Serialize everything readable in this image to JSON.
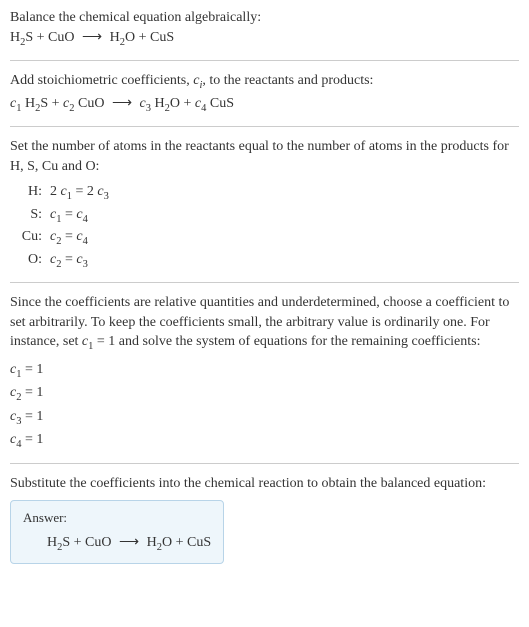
{
  "section1": {
    "line1": "Balance the chemical equation algebraically:",
    "eq_h2s": "H",
    "eq_2a": "2",
    "eq_s": "S + CuO ",
    "eq_arrow": "⟶",
    "eq_h2o": " H",
    "eq_2b": "2",
    "eq_o_cus": "O + CuS"
  },
  "section2": {
    "line1a": "Add stoichiometric coefficients, ",
    "ci_c": "c",
    "ci_i": "i",
    "line1b": ", to the reactants and products:",
    "c1": "c",
    "s1": "1",
    "h2s_h": " H",
    "h2s_2": "2",
    "h2s_s": "S + ",
    "c2": "c",
    "s2": "2",
    "cuo": " CuO ",
    "arrow": "⟶",
    "sp": " ",
    "c3": "c",
    "s3": "3",
    "h2o_h": " H",
    "h2o_2": "2",
    "h2o_o": "O + ",
    "c4": "c",
    "s4": "4",
    "cus": " CuS"
  },
  "section3": {
    "line1": "Set the number of atoms in the reactants equal to the number of atoms in the products for H, S, Cu and O:",
    "rows": [
      {
        "label": "H:",
        "lhs_coeff": "2 ",
        "lhs_c": "c",
        "lhs_sub": "1",
        "eq": " = 2 ",
        "rhs_c": "c",
        "rhs_sub": "3"
      },
      {
        "label": "S:",
        "lhs_coeff": "",
        "lhs_c": "c",
        "lhs_sub": "1",
        "eq": " = ",
        "rhs_c": "c",
        "rhs_sub": "4"
      },
      {
        "label": "Cu:",
        "lhs_coeff": "",
        "lhs_c": "c",
        "lhs_sub": "2",
        "eq": " = ",
        "rhs_c": "c",
        "rhs_sub": "4"
      },
      {
        "label": "O:",
        "lhs_coeff": "",
        "lhs_c": "c",
        "lhs_sub": "2",
        "eq": " = ",
        "rhs_c": "c",
        "rhs_sub": "3"
      }
    ]
  },
  "section4": {
    "line1a": "Since the coefficients are relative quantities and underdetermined, choose a coefficient to set arbitrarily. To keep the coefficients small, the arbitrary value is ordinarily one. For instance, set ",
    "c1_c": "c",
    "c1_sub": "1",
    "line1b": " = 1 and solve the system of equations for the remaining coefficients:",
    "coeffs": [
      {
        "c": "c",
        "sub": "1",
        "val": " = 1"
      },
      {
        "c": "c",
        "sub": "2",
        "val": " = 1"
      },
      {
        "c": "c",
        "sub": "3",
        "val": " = 1"
      },
      {
        "c": "c",
        "sub": "4",
        "val": " = 1"
      }
    ]
  },
  "section5": {
    "line1": "Substitute the coefficients into the chemical reaction to obtain the balanced equation:",
    "answer_label": "Answer:",
    "eq_h2s": "H",
    "eq_2a": "2",
    "eq_s": "S + CuO ",
    "eq_arrow": "⟶",
    "eq_h2o": " H",
    "eq_2b": "2",
    "eq_o_cus": "O + CuS"
  }
}
